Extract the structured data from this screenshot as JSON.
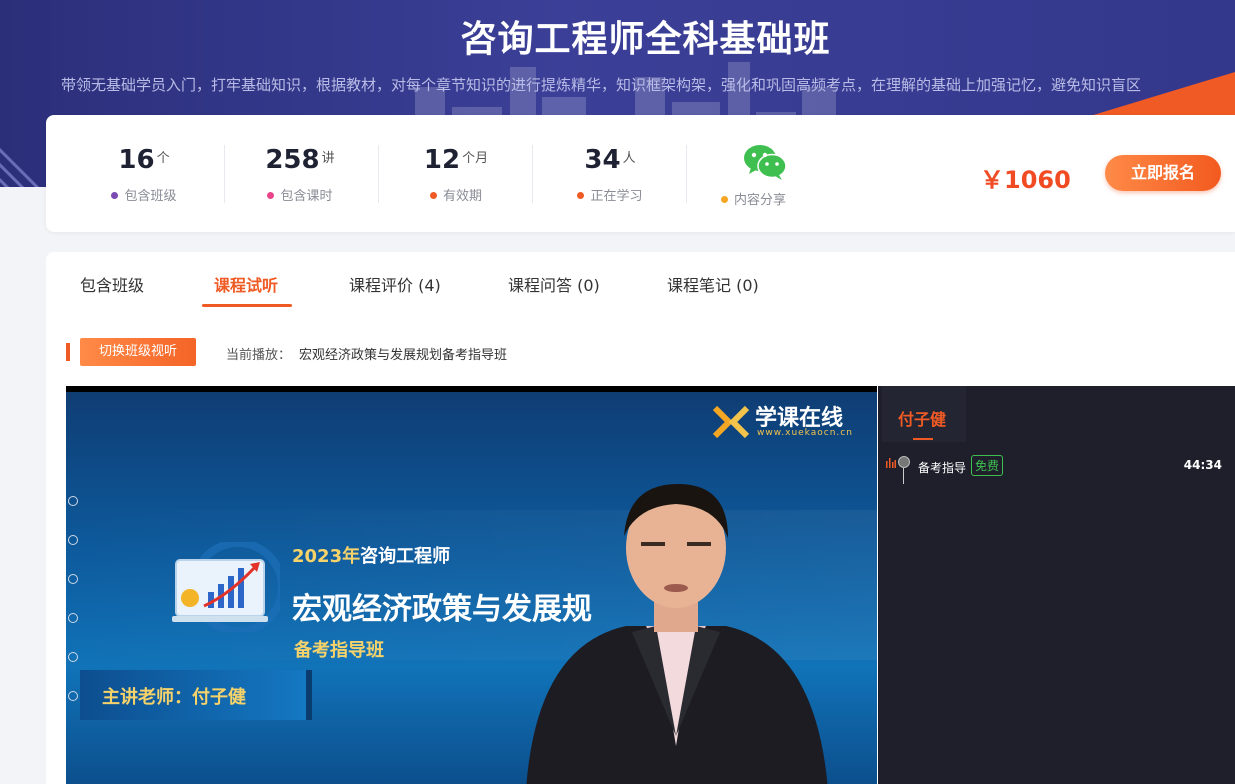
{
  "header": {
    "title": "咨询工程师全科基础班",
    "subtitle": "带领无基础学员入门，打牢基础知识，根据教材，对每个章节知识的进行提炼精华，知识框架构架，强化和巩固高频考点，在理解的基础上加强记忆，避免知识盲区"
  },
  "stats": [
    {
      "value": "16",
      "unit": "个",
      "label": "包含班级",
      "dot_color": "#7a4bb3"
    },
    {
      "value": "258",
      "unit": "讲",
      "label": "包含课时",
      "dot_color": "#e8458b"
    },
    {
      "value": "12",
      "unit": "个月",
      "label": "有效期",
      "dot_color": "#f05a24"
    },
    {
      "value": "34",
      "unit": "人",
      "label": "正在学习",
      "dot_color": "#f05a24"
    }
  ],
  "share": {
    "label": "内容分享",
    "dot_color": "#f5a623",
    "icon": "wechat-icon"
  },
  "price": "￥1060",
  "enroll_label": "立即报名",
  "tabs": [
    {
      "label": "包含班级"
    },
    {
      "label": "课程试听"
    },
    {
      "label": "课程评价 (4)"
    },
    {
      "label": "课程问答 (0)"
    },
    {
      "label": "课程笔记 (0)"
    }
  ],
  "active_tab": 1,
  "switch_label": "切换班级视听",
  "now_playing": {
    "prefix": "当前播放：",
    "title": "宏观经济政策与发展规划备考指导班"
  },
  "video": {
    "logo_text": "学课在线",
    "logo_url": "www.xuekaocn.cn",
    "year": "2023年",
    "exam": "咨询工程师",
    "title": "宏观经济政策与发展规",
    "subtitle": "备考指导班",
    "teacher": "主讲老师：付子健"
  },
  "playlist": {
    "tab": "付子健",
    "items": [
      {
        "name": "备考指导",
        "badge": "免费",
        "duration": "44:34"
      }
    ]
  },
  "colors": {
    "accent": "#f05a24",
    "hero": "#34388c"
  }
}
